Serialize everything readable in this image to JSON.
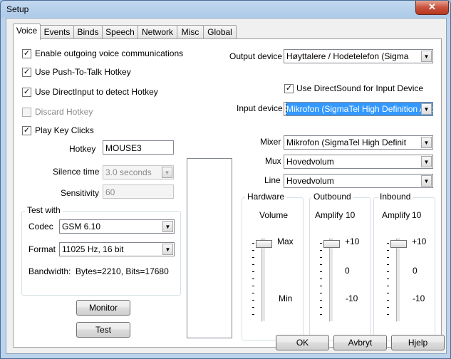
{
  "window": {
    "title": "Setup",
    "close_glyph": "✕"
  },
  "tabs": [
    "Voice",
    "Events",
    "Binds",
    "Speech",
    "Network",
    "Misc",
    "Global"
  ],
  "voice": {
    "enable_outgoing": {
      "label": "Enable outgoing voice communications",
      "checked": true
    },
    "push_to_talk": {
      "label": "Use Push-To-Talk Hotkey",
      "checked": true
    },
    "directinput": {
      "label": "Use DirectInput to detect Hotkey",
      "checked": true
    },
    "discard_hotkey": {
      "label": "Discard Hotkey",
      "checked": false,
      "disabled": true
    },
    "play_key_clicks": {
      "label": "Play Key Clicks",
      "checked": true
    },
    "hotkey": {
      "label": "Hotkey",
      "value": "MOUSE3"
    },
    "silence_time": {
      "label": "Silence time",
      "value": "3.0 seconds"
    },
    "sensitivity": {
      "label": "Sensitivity",
      "value": "60"
    },
    "test_with": {
      "title": "Test with",
      "codec_label": "Codec",
      "codec_value": "GSM 6.10",
      "format_label": "Format",
      "format_value": "11025 Hz, 16 bit",
      "bandwidth_label": "Bandwidth:",
      "bandwidth_value": "Bytes=2210, Bits=17680"
    },
    "monitor_button": "Monitor",
    "test_button": "Test",
    "output_device": {
      "label": "Output device",
      "value": "Høyttalere / Hodetelefon (Sigma"
    },
    "use_directsound": {
      "label": "Use DirectSound for Input Device",
      "checked": true
    },
    "input_device": {
      "label": "Input device",
      "value": "Mikrofon (SigmaTel High Definition Audi"
    },
    "mixer": {
      "label": "Mixer",
      "value": "Mikrofon (SigmaTel High Definit"
    },
    "mux": {
      "label": "Mux",
      "value": "Hovedvolum"
    },
    "line": {
      "label": "Line",
      "value": "Hovedvolum"
    },
    "hardware": {
      "title": "Hardware",
      "header": "Volume",
      "max": "Max",
      "min": "Min",
      "level": 1.0
    },
    "outbound": {
      "title": "Outbound",
      "header": "Amplify",
      "value": "10",
      "top": "+10",
      "mid": "0",
      "bottom": "-10",
      "level": 1.0
    },
    "inbound": {
      "title": "Inbound",
      "header": "Amplify",
      "value": "10",
      "top": "+10",
      "mid": "0",
      "bottom": "-10",
      "level": 1.0
    }
  },
  "footer": {
    "ok": "OK",
    "cancel": "Avbryt",
    "help": "Hjelp"
  }
}
